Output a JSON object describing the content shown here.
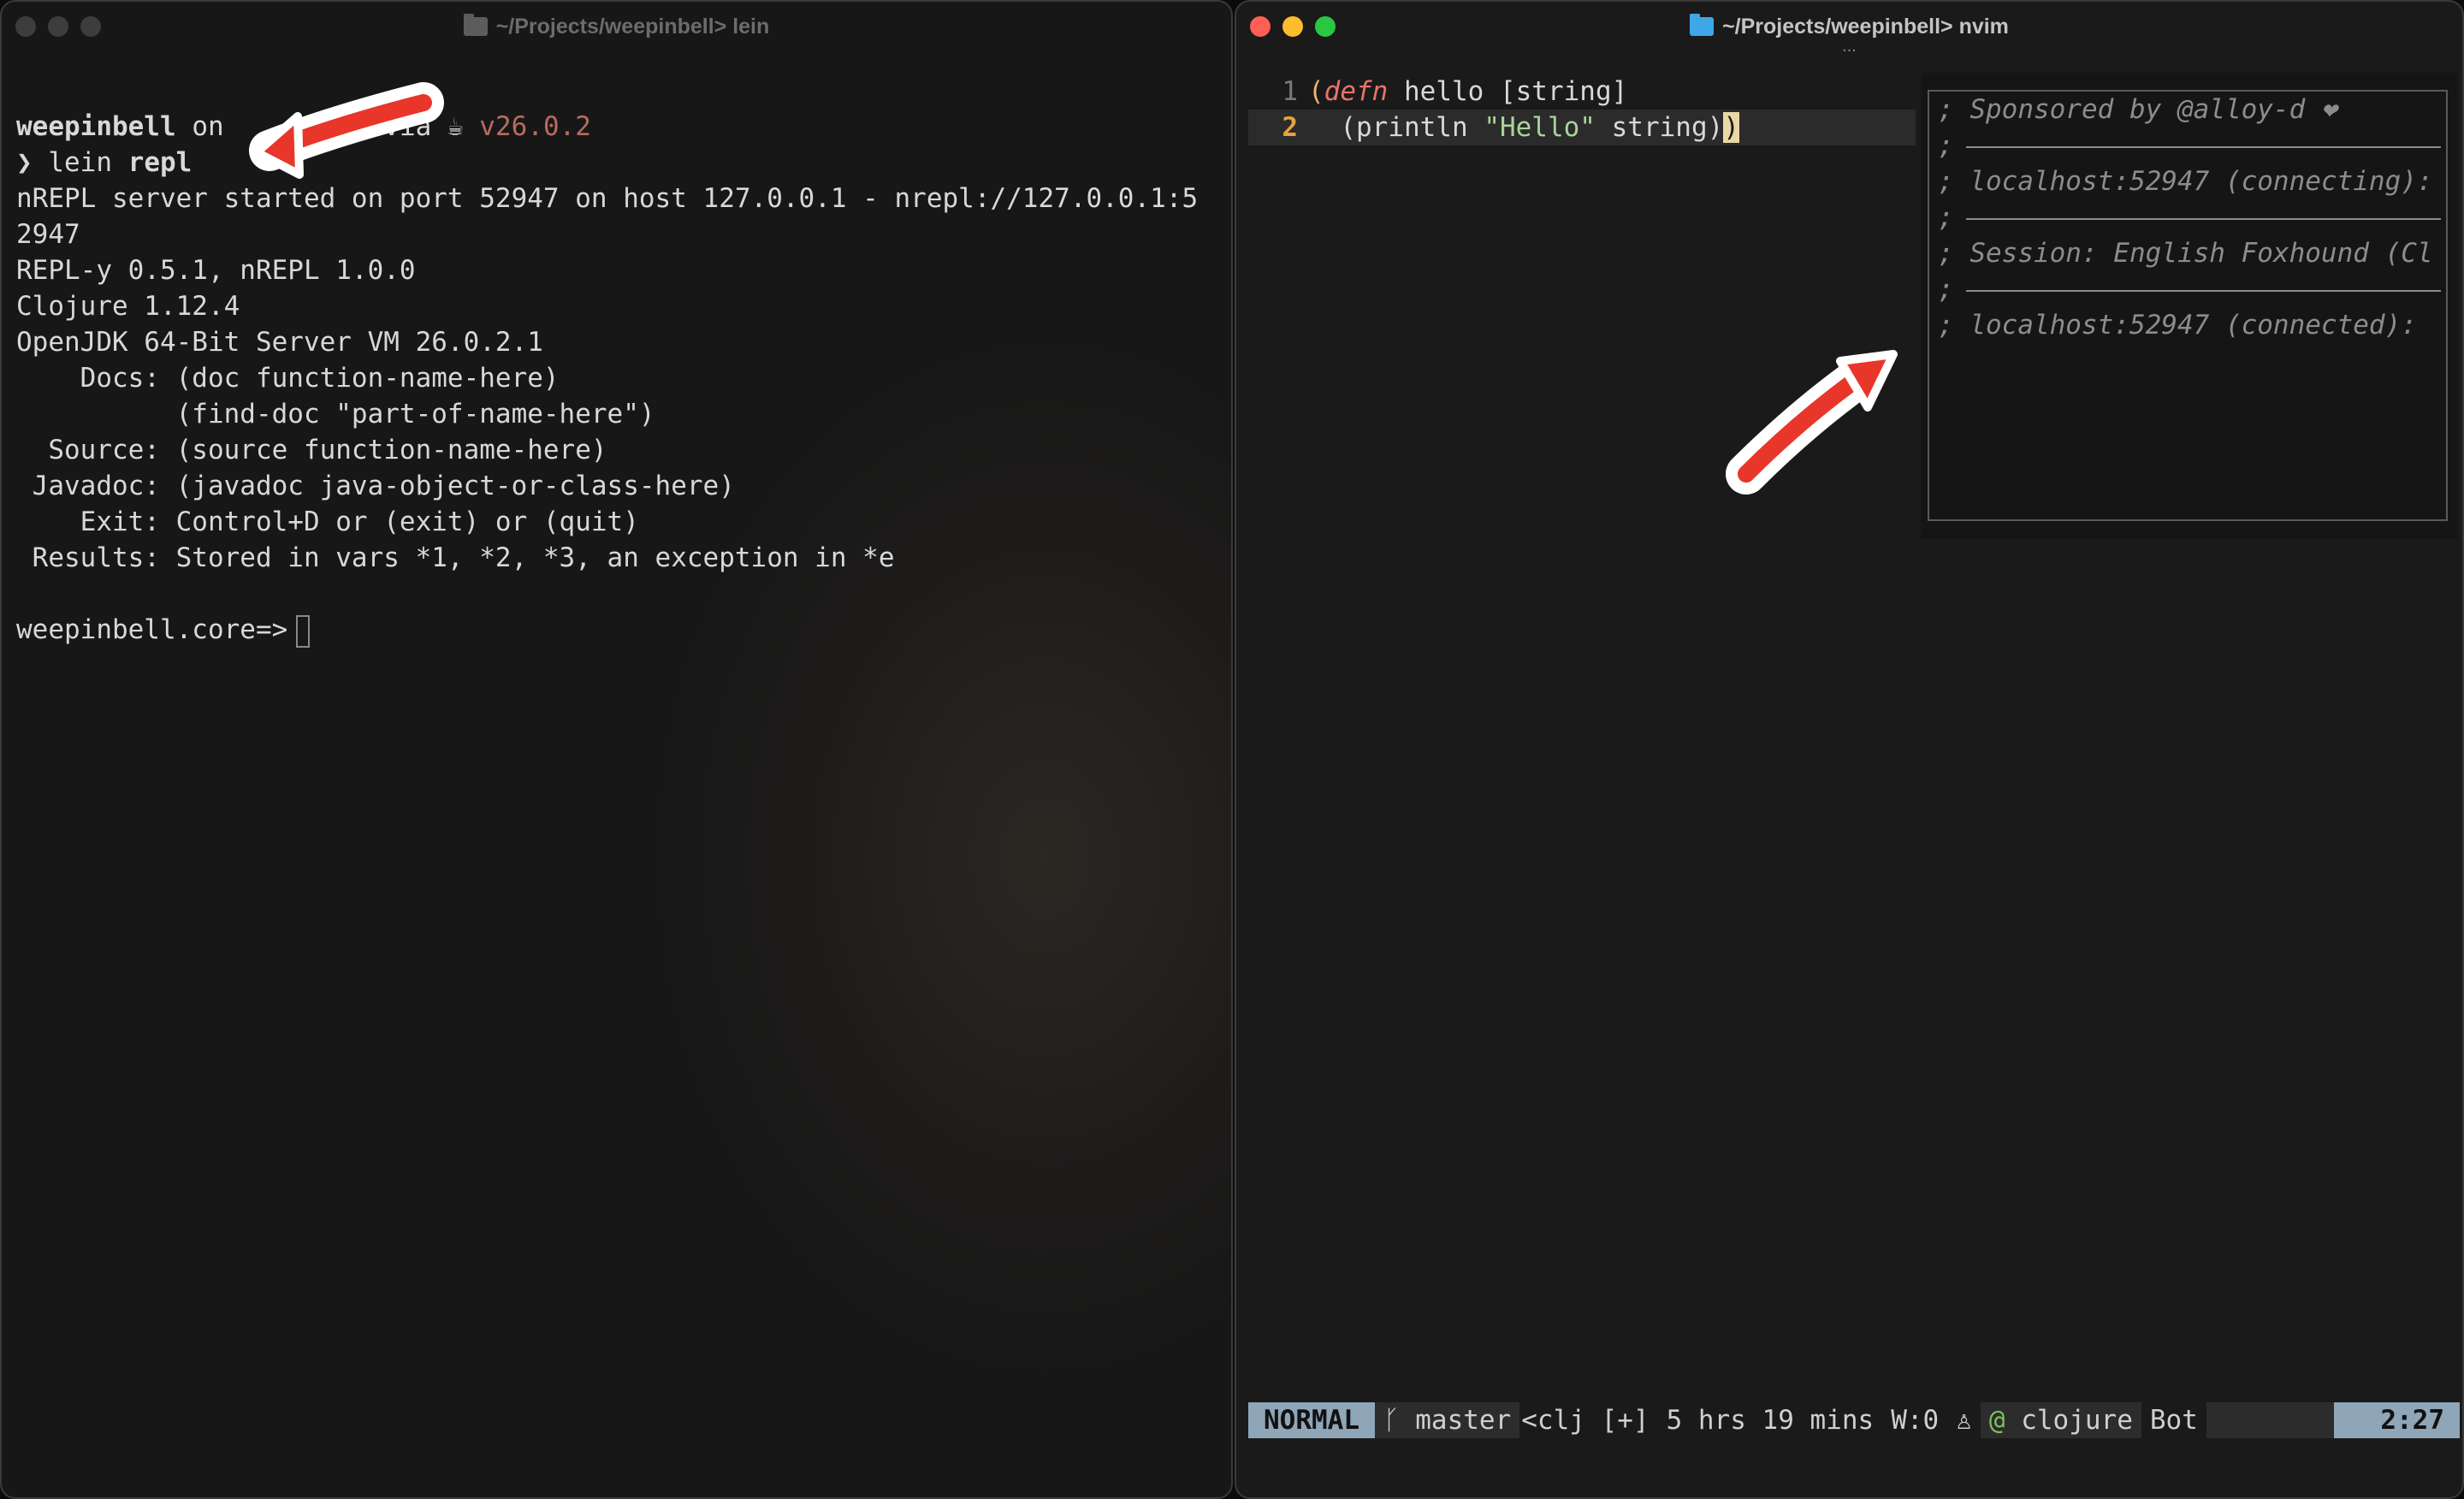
{
  "left_window": {
    "title": "~/Projects/weepinbell> lein",
    "prompt": {
      "dir": "weepinbell",
      "on": "on",
      "via": "via",
      "java_icon": "☕",
      "version": "v26.0.2",
      "symbol": "❯",
      "cmd": "lein",
      "arg": "repl"
    },
    "lines": [
      "nREPL server started on port 52947 on host 127.0.0.1 - nrepl://127.0.0.1:5",
      "2947",
      "REPL-y 0.5.1, nREPL 1.0.0",
      "Clojure 1.12.4",
      "OpenJDK 64-Bit Server VM 26.0.2.1",
      "    Docs: (doc function-name-here)",
      "          (find-doc \"part-of-name-here\")",
      "  Source: (source function-name-here)",
      " Javadoc: (javadoc java-object-or-class-here)",
      "    Exit: Control+D or (exit) or (quit)",
      " Results: Stored in vars *1, *2, *3, an exception in *e"
    ],
    "repl_prompt": "weepinbell.core=>"
  },
  "right_window": {
    "title": "~/Projects/weepinbell> nvim",
    "subtitle": "...",
    "code": [
      {
        "num": "1",
        "tokens": [
          {
            "t": "(",
            "c": "#e9b66d"
          },
          {
            "t": "defn",
            "c": "#e8736a",
            "i": true
          },
          {
            "t": " hello [string]",
            "c": "#d8d8d8"
          }
        ]
      },
      {
        "num": "2",
        "current": true,
        "tokens": [
          {
            "t": "  (println ",
            "c": "#d8d8d8"
          },
          {
            "t": "\"Hello\"",
            "c": "#a9d49a"
          },
          {
            "t": " string)",
            "c": "#d8d8d8"
          },
          {
            "t": ")",
            "c": "#1a1a1a",
            "cursor": true
          }
        ]
      }
    ],
    "popup_lines": [
      {
        "text": "; Sponsored by @alloy-d ❤"
      },
      {
        "text": ";",
        "sep": true
      },
      {
        "text": "; localhost:52947 (connecting):"
      },
      {
        "text": ";",
        "sep": true
      },
      {
        "text": "; Session: English Foxhound (Cl"
      },
      {
        "text": ";",
        "sep": true
      },
      {
        "text": "; localhost:52947 (connected):"
      }
    ],
    "statusline": {
      "mode": "NORMAL",
      "branch_icon": "ᚴ",
      "branch": "master",
      "file": "<clj [+]",
      "time": "5 hrs 19 mins",
      "words": "W:0",
      "lsp_icon": "♙",
      "ft_icon": "@",
      "filetype": "clojure",
      "scroll": "Bot",
      "position": "2:27"
    }
  },
  "colors": {
    "accent_red": "#e8362a",
    "nvim_mode_bg": "#8fa5b8",
    "close": "#ff5f57",
    "minimize": "#febc2e",
    "zoom": "#28c840",
    "folder_left": "#5c5c5c",
    "folder_right": "#3fa7e8"
  }
}
